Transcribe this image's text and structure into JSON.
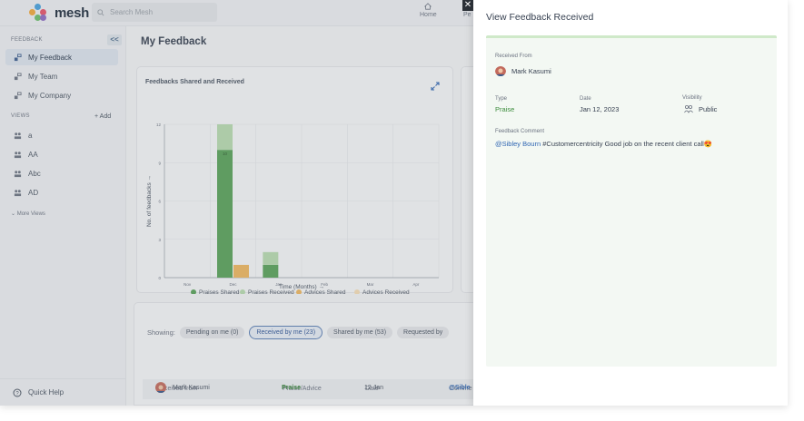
{
  "app": {
    "brand": "mesh"
  },
  "topbar": {
    "search_placeholder": "Search Mesh",
    "nav": [
      {
        "label": "Home",
        "icon": "home-icon"
      },
      {
        "label": "Pe",
        "icon": "people-icon"
      }
    ]
  },
  "sidebar": {
    "feedback_header": "FEEDBACK",
    "collapse_label": "<<",
    "items": [
      {
        "label": "My Feedback",
        "icon": "feedback-icon",
        "active": true
      },
      {
        "label": "My Team",
        "icon": "feedback-icon"
      },
      {
        "label": "My Company",
        "icon": "feedback-icon"
      }
    ],
    "views_header": "VIEWS",
    "add_label": "+ Add",
    "views": [
      {
        "label": "a"
      },
      {
        "label": "AA"
      },
      {
        "label": "Abc"
      },
      {
        "label": "AD"
      }
    ],
    "more_views": "More Views",
    "quick_help": "Quick Help"
  },
  "main": {
    "title": "My Feedback",
    "chart_card_title": "Feedbacks Shared and Received",
    "showing_label": "Showing:",
    "filters": [
      {
        "label": "Pending on me (0)",
        "selected": false
      },
      {
        "label": "Received by me (23)",
        "selected": true
      },
      {
        "label": "Shared by me (53)",
        "selected": false
      },
      {
        "label": "Requested by",
        "selected": false
      }
    ],
    "table": {
      "headers": [
        "Received from",
        "Praise/Advice",
        "Date",
        "Comme"
      ],
      "rows": [
        {
          "from": "Mark Kasumi",
          "type": "Praise",
          "date": "12 Jan",
          "comment": "@Sible"
        }
      ]
    }
  },
  "chart_data": {
    "type": "bar",
    "stacked": true,
    "title": "Feedbacks Shared and Received",
    "xlabel": "Time (Months) →",
    "ylabel": "No. of feedbacks →",
    "categories": [
      "Nov",
      "Dec",
      "Jan",
      "Feb",
      "Mar",
      "Apr"
    ],
    "ylim": [
      0,
      12
    ],
    "yticks": [
      0,
      3,
      6,
      9,
      12
    ],
    "series": [
      {
        "name": "Praises Shared",
        "color": "#5aa35a",
        "values": [
          0,
          10,
          1,
          0,
          0,
          0
        ]
      },
      {
        "name": "Praises Received",
        "color": "#b9dcb0",
        "values": [
          0,
          2,
          1,
          0,
          0,
          0
        ]
      },
      {
        "name": "Advices Shared",
        "color": "#f0b860",
        "values": [
          0,
          1,
          0,
          0,
          0,
          0
        ]
      },
      {
        "name": "Advices Received",
        "color": "#f7dfb8",
        "values": [
          0,
          0,
          0,
          0,
          0,
          0
        ]
      }
    ],
    "data_labels": [
      {
        "category": "Dec",
        "text": "10"
      }
    ],
    "grid": true,
    "legend": "bottom"
  },
  "panel": {
    "title": "View Feedback Received",
    "close_label": "✕",
    "received_from_label": "Received From",
    "received_from": "Mark Kasumi",
    "type_label": "Type",
    "type": "Praise",
    "date_label": "Date",
    "date": "Jan 12, 2023",
    "visibility_label": "Visibility",
    "visibility": "Public",
    "comment_label": "Feedback Comment",
    "comment_mention": "@Sibley Bourn",
    "comment_tag": "#Customercentricity",
    "comment_text": " Good job on the recent client call",
    "comment_emoji": "😍"
  },
  "colors": {
    "accent": "#2f5597",
    "praise": "#3c8c3c",
    "panel_bg": "#f3f8f3"
  }
}
